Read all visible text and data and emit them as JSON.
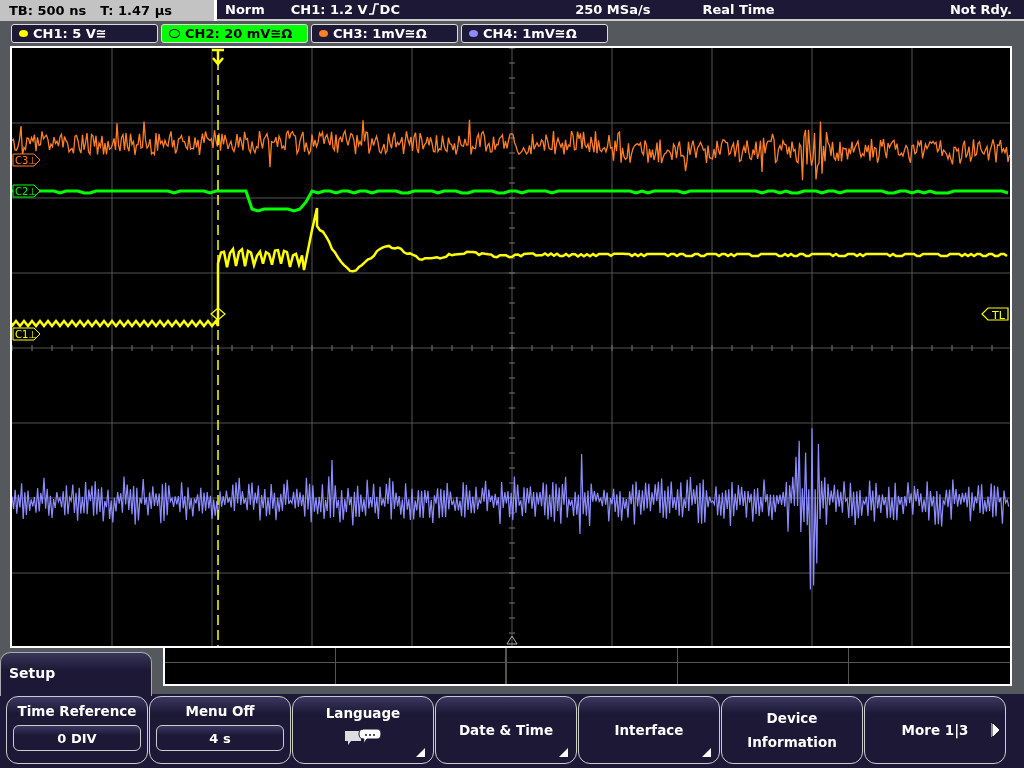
{
  "status_bar": {
    "timebase": "TB: 500 ns",
    "trigger_time": "T: 1.47 µs",
    "trigger_mode": "Norm",
    "trigger_source": "CH1: 1.2 V",
    "coupling": "DC",
    "sample_rate": "250 MSa/s",
    "acquisition_mode": "Real Time",
    "state": "Not Rdy."
  },
  "channels": [
    {
      "label": "CH1: 5 V≅",
      "color": "#ffff00",
      "selected": false
    },
    {
      "label": "CH2: 20 mV≅Ω",
      "color": "#00ff00",
      "selected": true
    },
    {
      "label": "CH3: 1mV≅Ω",
      "color": "#ff7f27",
      "selected": false
    },
    {
      "label": "CH4: 1mV≅Ω",
      "color": "#8c8cff",
      "selected": false
    }
  ],
  "plot": {
    "markers": [
      {
        "label": "C3⊥",
        "color": "#ff7f27"
      },
      {
        "label": "C2⊥",
        "color": "#00ff00"
      },
      {
        "label": "C1⊥",
        "color": "#ffff00"
      }
    ],
    "trigger_level_label": "TL"
  },
  "menu": {
    "title": "Setup",
    "softkeys": [
      {
        "kind": "value",
        "label": "Time Reference",
        "value": "0 DIV"
      },
      {
        "kind": "value",
        "label": "Menu Off",
        "value": "4 s"
      },
      {
        "kind": "language",
        "label": "Language"
      },
      {
        "kind": "submenu",
        "label": "Date & Time"
      },
      {
        "kind": "submenu",
        "label": "Interface"
      },
      {
        "kind": "plain",
        "label": "Device Information"
      },
      {
        "kind": "next",
        "label": "More 1|3"
      }
    ]
  }
}
